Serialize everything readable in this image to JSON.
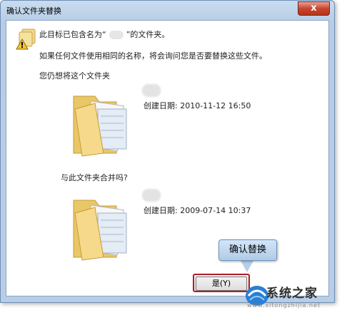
{
  "window": {
    "title": "确认文件夹替换",
    "close_glyph": "x"
  },
  "message": {
    "line1_pre": "此目标已包含名为“",
    "line1_post": "”的文件夹。",
    "line2": "如果任何文件使用相同的名称，将会询问您是否要替换这些文件。",
    "line3": "您仍想将这个文件夹"
  },
  "source_folder": {
    "date": "创建日期: 2010-11-12 16:50"
  },
  "merge_question": "与此文件夹合并吗?",
  "target_folder": {
    "date": "创建日期: 2009-07-14 10:37"
  },
  "buttons": {
    "yes": "是(Y)"
  },
  "callout": {
    "label": "确认替换"
  },
  "watermark": {
    "text": "系统之家",
    "url": "www.xitongzhijia.net"
  },
  "colors": {
    "highlight": "#b01c2a",
    "callout": "#c3d9f0",
    "folder": "#f1d27a"
  }
}
